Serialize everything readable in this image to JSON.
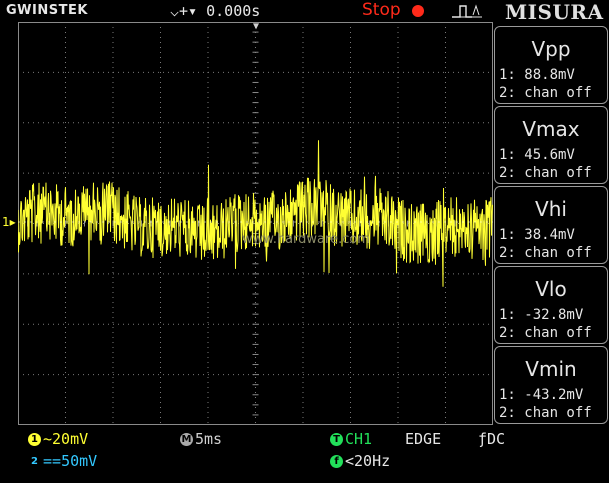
{
  "header": {
    "brand": "GWINSTEK",
    "trigger_position": "0.000s",
    "run_state": "Stop",
    "watermark": "MISURA"
  },
  "colors": {
    "ch1": "#ffff33",
    "ch2": "#33c8ff",
    "stop": "#ff2a1a",
    "trigger": "#22e05a",
    "text": "#e6e6e6"
  },
  "grid": {
    "ch1_marker": "1",
    "center_text": "www.hardware.com"
  },
  "measurements": [
    {
      "title": "Vpp",
      "ch1": "1: 88.8mV",
      "ch2": "2: chan off"
    },
    {
      "title": "Vmax",
      "ch1": "1: 45.6mV",
      "ch2": "2: chan off"
    },
    {
      "title": "Vhi",
      "ch1": "1: 38.4mV",
      "ch2": "2: chan off"
    },
    {
      "title": "Vlo",
      "ch1": "1: -32.8mV",
      "ch2": "2: chan off"
    },
    {
      "title": "Vmin",
      "ch1": "1: -43.2mV",
      "ch2": "2: chan off"
    }
  ],
  "bottom": {
    "ch1_coupling": "~",
    "ch1_scale": "20mV",
    "ch2_coupling": "==",
    "ch2_scale": "50mV",
    "timebase_badge": "M",
    "timebase": "5ms",
    "trigger_badge": "T",
    "trigger_source": "CH1",
    "trigger_type": "EDGE",
    "trigger_coupling": "DC",
    "filter_badge": "f",
    "filter_value": "<20Hz",
    "ch1_badge": "1",
    "ch2_badge": "2"
  }
}
